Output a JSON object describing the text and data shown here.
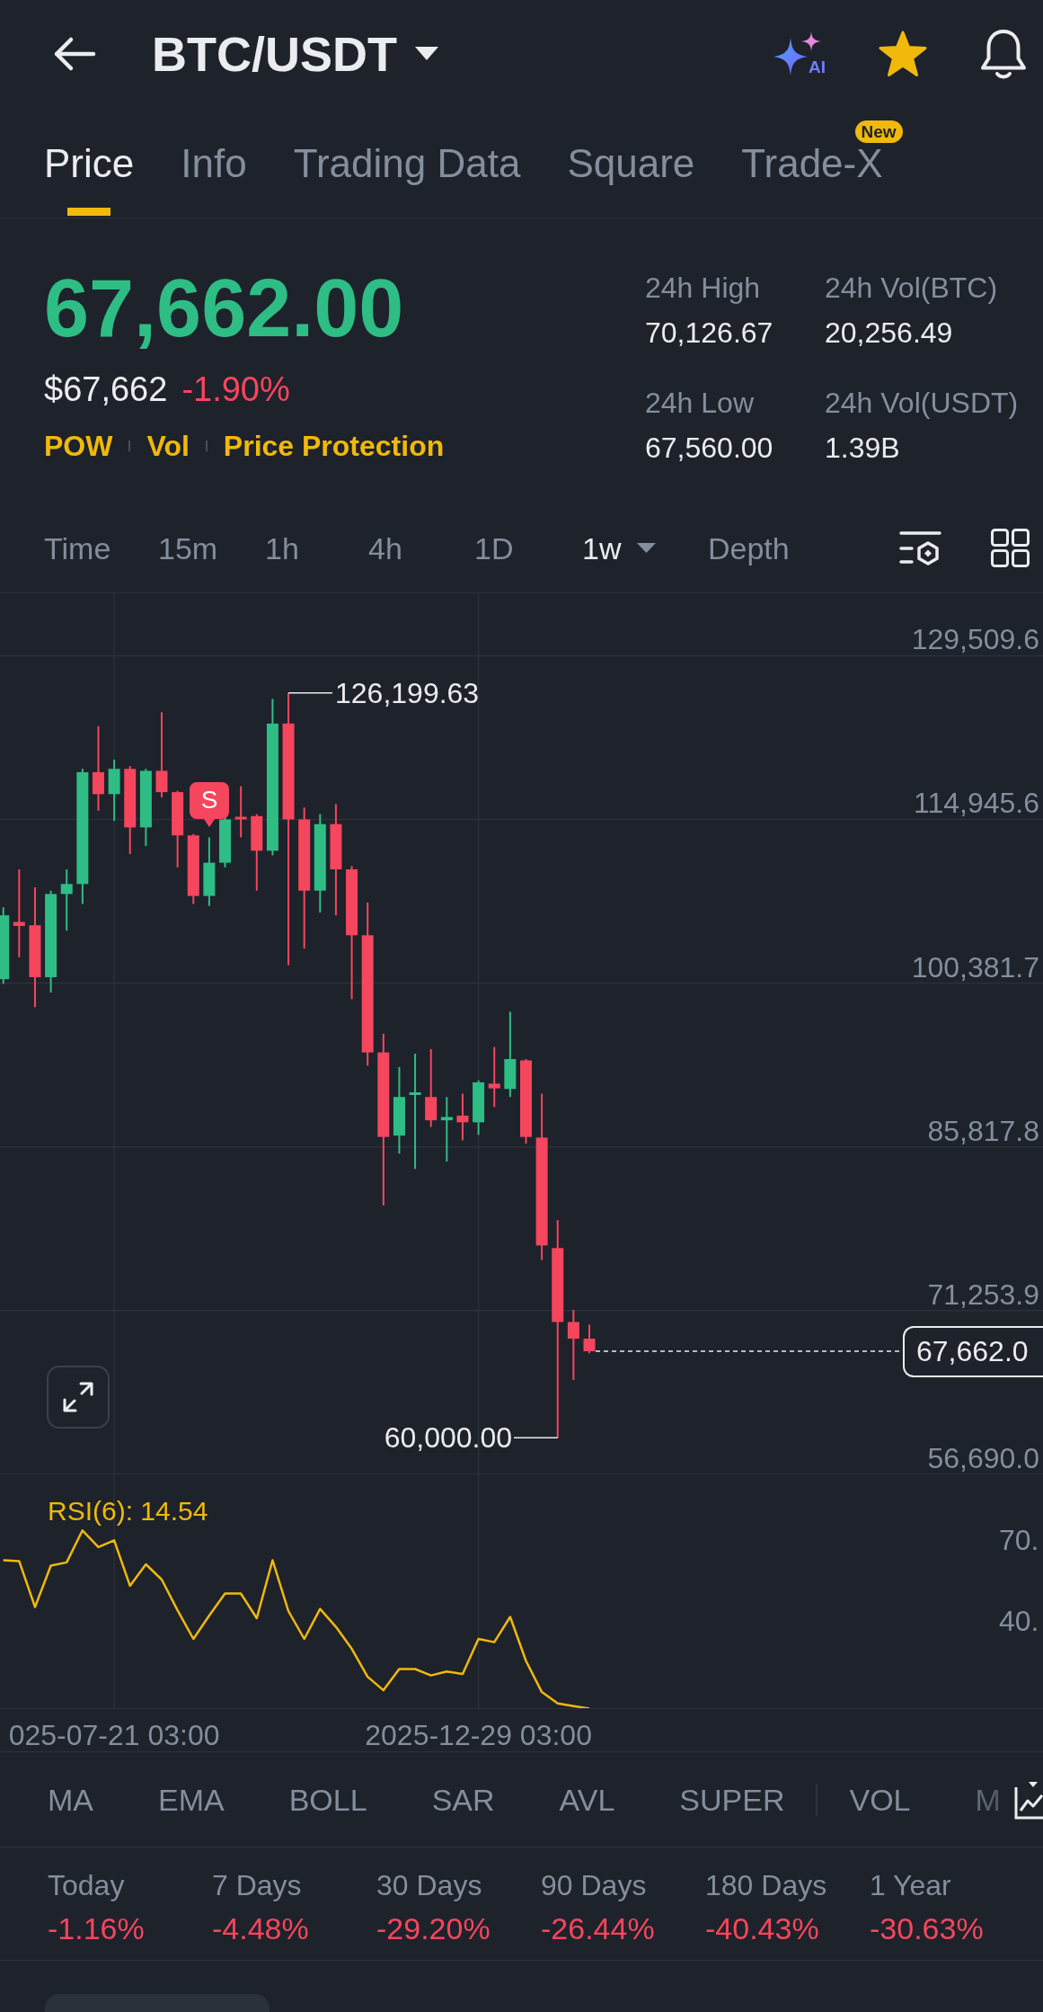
{
  "header": {
    "title": "BTC/USDT",
    "ai_label": "AI",
    "favorite": true
  },
  "tabs": [
    {
      "label": "Price",
      "selected": true
    },
    {
      "label": "Info",
      "selected": false
    },
    {
      "label": "Trading Data",
      "selected": false
    },
    {
      "label": "Square",
      "selected": false
    },
    {
      "label": "Trade-X",
      "selected": false,
      "badge": "New"
    }
  ],
  "price": {
    "last": "67,662.00",
    "last_rising": true,
    "usd": "$67,662",
    "change": "-1.90%",
    "change_rising": false,
    "tags": [
      "POW",
      "Vol",
      "Price Protection"
    ]
  },
  "stats": [
    {
      "label": "24h High",
      "value": "70,126.67"
    },
    {
      "label": "24h Vol(BTC)",
      "value": "20,256.49"
    },
    {
      "label": "24h Low",
      "value": "67,560.00"
    },
    {
      "label": "24h Vol(USDT)",
      "value": "1.39B"
    }
  ],
  "intervals": [
    {
      "label": "Time",
      "selected": false,
      "menu": false
    },
    {
      "label": "15m",
      "selected": false,
      "menu": false
    },
    {
      "label": "1h",
      "selected": false,
      "menu": false
    },
    {
      "label": "4h",
      "selected": false,
      "menu": false
    },
    {
      "label": "1D",
      "selected": false,
      "menu": false
    },
    {
      "label": "1w",
      "selected": true,
      "menu": true
    },
    {
      "label": "Depth",
      "selected": false,
      "menu": false
    }
  ],
  "candle_chart": {
    "price_axis": [
      "129,509.6",
      "114,945.6",
      "100,381.7",
      "85,817.8",
      "71,253.9",
      "56,690.0"
    ],
    "high_marker": "126,199.63",
    "low_marker": "60,000.00",
    "last_price": "67,662.0",
    "signal": "S"
  },
  "rsi": {
    "label": "RSI(6): 14.54",
    "axis_labels": [
      "70.",
      "40."
    ]
  },
  "time_axis": [
    "025-07-21 03:00",
    "2025-12-29 03:00"
  ],
  "indicators": {
    "main": [
      "MA",
      "EMA",
      "BOLL",
      "SAR",
      "AVL",
      "SUPER"
    ],
    "sub": [
      "VOL",
      "M"
    ]
  },
  "performance": [
    {
      "label": "Today",
      "value": "-1.16%",
      "rising": false
    },
    {
      "label": "7 Days",
      "value": "-4.48%",
      "rising": false
    },
    {
      "label": "30 Days",
      "value": "-29.20%",
      "rising": false
    },
    {
      "label": "90 Days",
      "value": "-26.44%",
      "rising": false
    },
    {
      "label": "180 Days",
      "value": "-40.43%",
      "rising": false
    },
    {
      "label": "1 Year",
      "value": "-30.63%",
      "rising": false
    }
  ]
}
